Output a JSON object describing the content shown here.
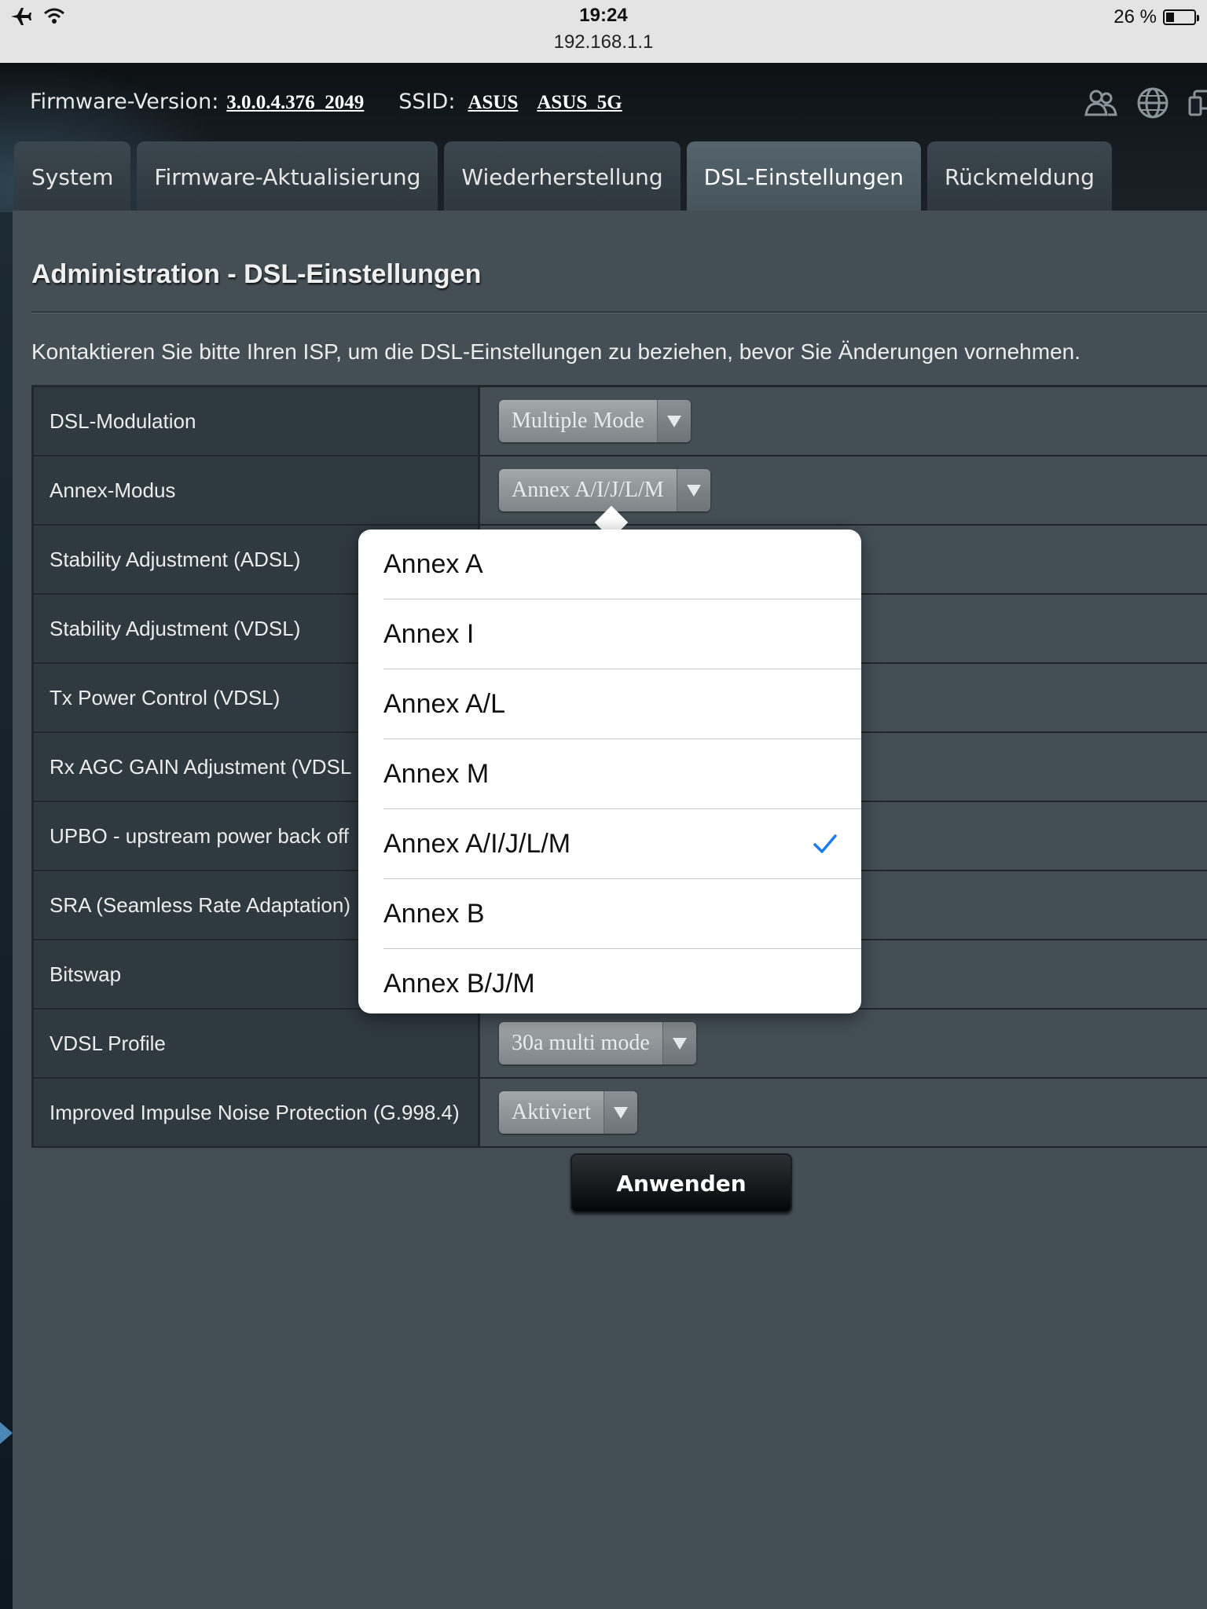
{
  "status_bar": {
    "time": "19:24",
    "url": "192.168.1.1",
    "battery": "26 %",
    "battery_level_percent": 26,
    "icons": [
      "airplane-icon",
      "wifi-icon",
      "battery-icon"
    ]
  },
  "header": {
    "firmware_label": "Firmware-Version:",
    "firmware_version": "3.0.0.4.376_2049",
    "ssid_label": "SSID:",
    "ssid_1": "ASUS",
    "ssid_2": "ASUS_5G",
    "icons": [
      "users-icon",
      "globe-icon",
      "devices-icon"
    ]
  },
  "tabs": [
    {
      "label": "System",
      "active": false
    },
    {
      "label": "Firmware-Aktualisierung",
      "active": false
    },
    {
      "label": "Wiederherstellung",
      "active": false
    },
    {
      "label": "DSL-Einstellungen",
      "active": true
    },
    {
      "label": "Rückmeldung",
      "active": false
    }
  ],
  "page": {
    "title": "Administration - DSL-Einstellungen",
    "hint": "Kontaktieren Sie bitte Ihren ISP, um die DSL-Einstellungen zu beziehen, bevor Sie Änderungen vornehmen.",
    "apply_label": "Anwenden"
  },
  "settings": [
    {
      "label": "DSL-Modulation",
      "value": "Multiple Mode"
    },
    {
      "label": "Annex-Modus",
      "value": "Annex A/I/J/L/M"
    },
    {
      "label": "Stability Adjustment (ADSL)",
      "value": ""
    },
    {
      "label": "Stability Adjustment (VDSL)",
      "value": ""
    },
    {
      "label": "Tx Power Control (VDSL)",
      "value": ""
    },
    {
      "label": "Rx AGC GAIN Adjustment (VDSL",
      "value": ""
    },
    {
      "label": "UPBO - upstream power back off",
      "value": ""
    },
    {
      "label": "SRA (Seamless Rate Adaptation)",
      "value": ""
    },
    {
      "label": "Bitswap",
      "value": ""
    },
    {
      "label": "VDSL Profile",
      "value": "30a multi mode"
    },
    {
      "label": "Improved Impulse Noise Protection (G.998.4)",
      "value": "Aktiviert"
    }
  ],
  "annex_popover": {
    "options": [
      {
        "label": "Annex A",
        "selected": false
      },
      {
        "label": "Annex I",
        "selected": false
      },
      {
        "label": "Annex A/L",
        "selected": false
      },
      {
        "label": "Annex M",
        "selected": false
      },
      {
        "label": "Annex A/I/J/L/M",
        "selected": true
      },
      {
        "label": "Annex B",
        "selected": false
      },
      {
        "label": "Annex B/J/M",
        "selected": false
      }
    ],
    "check_color": "#1a7cf5"
  }
}
